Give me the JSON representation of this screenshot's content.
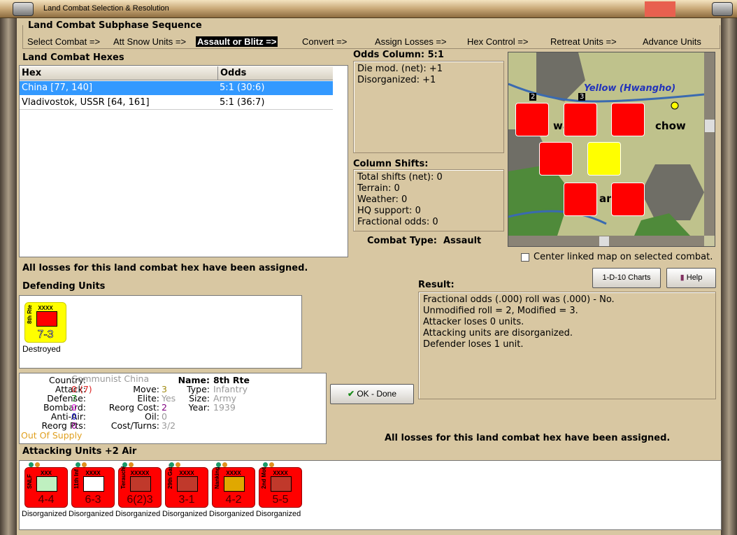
{
  "window": {
    "title": "Land Combat Selection & Resolution"
  },
  "sequence": {
    "title": "Land Combat Subphase Sequence",
    "steps": [
      "Select Combat =>",
      "Att Snow Units =>",
      "Assault or Blitz =>",
      "Convert =>",
      "Assign Losses =>",
      "Hex Control =>",
      "Retreat Units =>",
      "Advance Units"
    ],
    "current_index": 2
  },
  "hexes": {
    "title": "Land Combat Hexes",
    "columns": [
      "Hex",
      "Odds"
    ],
    "rows": [
      {
        "hex": "China [77, 140]",
        "odds": "5:1 (30:6)",
        "selected": true
      },
      {
        "hex": "Vladivostok, USSR [64, 161]",
        "odds": "5:1 (36:7)",
        "selected": false
      }
    ]
  },
  "odds": {
    "title": "Odds Column: 5:1",
    "lines": [
      "Die mod. (net): +1",
      "Disorganized: +1"
    ]
  },
  "shifts": {
    "title": "Column Shifts:",
    "lines": [
      "Total shifts (net): 0",
      "Terrain: 0",
      "Weather: 0",
      "HQ support: 0",
      "Fractional odds: 0"
    ]
  },
  "combat_type": {
    "label": "Combat Type:",
    "value": "Assault"
  },
  "map": {
    "river_label": "Yellow (Hwangho)",
    "city_fragments": [
      "wa",
      "chow",
      "an"
    ],
    "stack_counts": [
      "2",
      "3"
    ]
  },
  "center_checkbox": {
    "label": "Center linked map on selected combat.",
    "checked": false
  },
  "losses_msg": "All losses for this land combat hex have been assigned.",
  "buttons": {
    "charts": "1-D-10 Charts",
    "help": "Help",
    "ok": "OK - Done"
  },
  "defending": {
    "title": "Defending Units",
    "units": [
      {
        "name": "8th Rte",
        "size": "XXXX",
        "value": "7-3",
        "status": "Destroyed"
      }
    ]
  },
  "result": {
    "title": "Result:",
    "lines": [
      "Fractional odds (.000) roll was (.000)  - No.",
      "Unmodified roll = 2, Modified = 3.",
      "Attacker loses 0 units.",
      "Attacking units are disorganized.",
      "Defender loses 1 unit."
    ]
  },
  "unit_info": {
    "country_label": "Country:",
    "country": "Communist China",
    "attack_label": "Attack:",
    "attack": "0",
    "attack_orig": "(7)",
    "defense_label": "Defense:",
    "defense": "7",
    "bombard_label": "Bombard:",
    "bombard": "0",
    "antiair_label": "Anti-Air:",
    "antiair": "0",
    "reorgpts_label": "Reorg Pts:",
    "reorgpts": "0",
    "supply": "Out Of Supply",
    "move_label": "Move:",
    "move": "3",
    "elite_label": "Elite:",
    "elite": "Yes",
    "reorgcost_label": "Reorg Cost:",
    "reorgcost": "2",
    "oil_label": "Oil:",
    "oil": "0",
    "costturns_label": "Cost/Turns:",
    "costturns": "3/2",
    "name_label": "Name:",
    "name": "8th Rte",
    "type_label": "Type:",
    "type": "Infantry",
    "size_label": "Size:",
    "size": "Army",
    "year_label": "Year:",
    "year": "1939"
  },
  "losses_msg2": "All losses for this land combat hex have been assigned.",
  "attacking": {
    "title": "Attacking Units +2 Air",
    "units": [
      {
        "name": "SNLF",
        "size": "XXX",
        "value": "4-4",
        "status": "Disorganized",
        "sym": "#bff0c0"
      },
      {
        "name": "11th Inf",
        "size": "XXXX",
        "value": "6-3",
        "status": "Disorganized",
        "sym": "#ffffff"
      },
      {
        "name": "Terauchi",
        "size": "XXXXX",
        "value": "6(2)3",
        "status": "Disorganized",
        "sym": "#c0392b"
      },
      {
        "name": "29th Garr",
        "size": "XXXX",
        "value": "3-1",
        "status": "Disorganized",
        "sym": "#c0392b"
      },
      {
        "name": "Nanking",
        "size": "XXXX",
        "value": "4-2",
        "status": "Disorganized",
        "sym": "#e0a800"
      },
      {
        "name": "2nd Mot",
        "size": "XXXX",
        "value": "5-5",
        "status": "Disorganized",
        "sym": "#c0392b"
      }
    ]
  }
}
